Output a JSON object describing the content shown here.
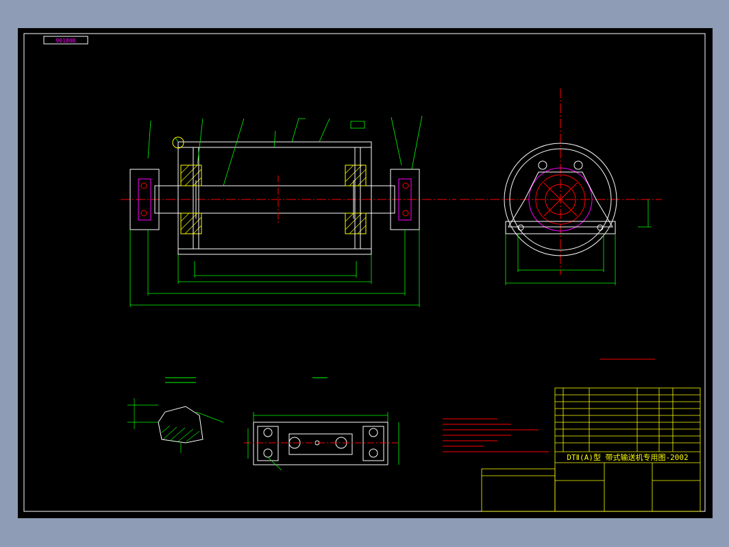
{
  "drawing": {
    "code_box": "90180B",
    "title_main": "DTⅡ(A)型 带式输送机专用图-2002",
    "colors": {
      "background": "#000000",
      "frame": "#ffffff",
      "outline": "#ffffff",
      "centerline": "#ff0000",
      "dimension": "#00ff00",
      "section": "#ffff00",
      "hidden": "#ff00ff",
      "leader": "#00ff00",
      "text_note": "#ff0000",
      "title_block": "#ffff00"
    },
    "icons": [
      "roller-drum-elevation",
      "end-view-bearing",
      "bearing-seat-plan",
      "weld-detail"
    ]
  }
}
